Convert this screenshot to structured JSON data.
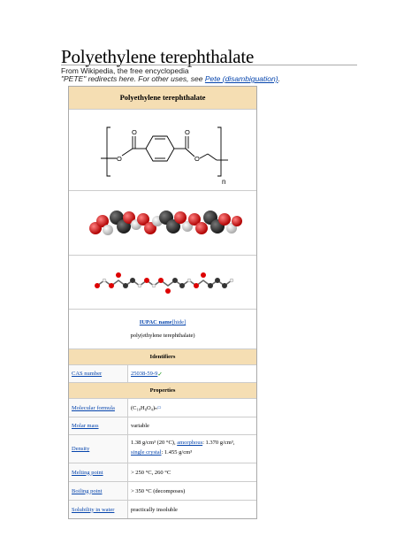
{
  "article": {
    "title": "Polyethylene terephthalate",
    "tagline": "From Wikipedia, the free encyclopedia",
    "hatnote_prefix": "\"PETE\" redirects here. For other uses, see ",
    "hatnote_link": "Pete (disambiguation)",
    "hatnote_suffix": "."
  },
  "infobox": {
    "header": "Polyethylene terephthalate",
    "structure_n": "n",
    "iupac_label": "IUPAC name",
    "iupac_hide": "[hide]",
    "iupac_value": "poly(ethylene terephthalate)",
    "identifiers_header": "Identifiers",
    "cas": {
      "label": "CAS number",
      "value": "25038-59-9",
      "check": "✓"
    },
    "properties_header": "Properties",
    "rows": [
      {
        "label": "Molecular formula",
        "value": "(C₁₀H₈O₄)ₙ",
        "ext": "▭"
      },
      {
        "label": "Molar mass",
        "value": "variable"
      },
      {
        "label": "Density",
        "line1": "1.38 g/cm³ (20 °C),",
        "link1": "amorphous",
        "line1b": ": 1.370 g/cm³,",
        "link2": "single crystal",
        "line2b": ": 1.455 g/cm³"
      },
      {
        "label": "Melting point",
        "value": "> 250 °C, 260 °C"
      },
      {
        "label": "Boiling point",
        "value": "> 350 °C (decomposes)"
      },
      {
        "label": "Solubility in water",
        "value": "practically insoluble"
      }
    ]
  }
}
